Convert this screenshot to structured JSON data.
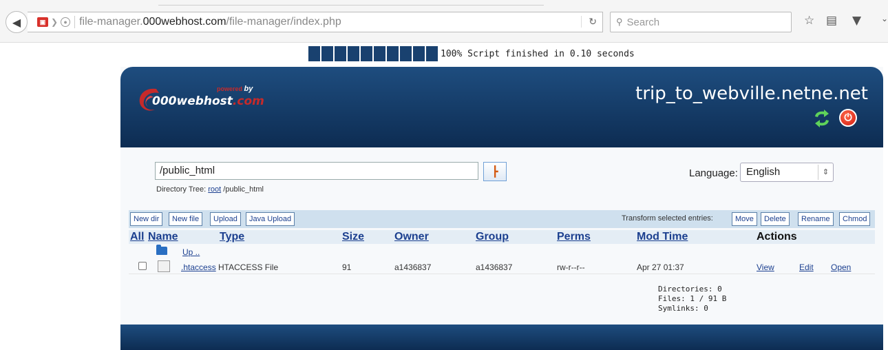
{
  "browser": {
    "url_prefix": "file-manager.",
    "url_host": "000webhost.com",
    "url_path": "/file-manager/index.php",
    "search_placeholder": "Search"
  },
  "progress": {
    "percent": 100,
    "text": "100% Script finished in 0.10 seconds"
  },
  "header": {
    "logo_powered": "powered",
    "logo_by": "by",
    "logo_name": "000webhost",
    "logo_suffix": ".com",
    "site_name": "trip_to_webville.netne.net"
  },
  "path": {
    "value": "/public_html",
    "tree_label": "Directory Tree:",
    "tree_root": "root",
    "tree_current": "/public_html"
  },
  "language": {
    "label": "Language:",
    "selected": "English"
  },
  "actions": {
    "new_dir": "New dir",
    "new_file": "New file",
    "upload": "Upload",
    "java_upload": "Java Upload",
    "transform_label": "Transform selected entries:",
    "move": "Move",
    "delete": "Delete",
    "rename": "Rename",
    "chmod": "Chmod"
  },
  "columns": {
    "all": "All",
    "name": "Name",
    "type": "Type",
    "size": "Size",
    "owner": "Owner",
    "group": "Group",
    "perms": "Perms",
    "mod_time": "Mod Time",
    "actions": "Actions"
  },
  "up_link": "Up ..",
  "files": [
    {
      "name": ".htaccess",
      "type": "HTACCESS File",
      "size": "91",
      "owner": "a1436837",
      "group": "a1436837",
      "perms": "rw-r--r--",
      "mod_time": "Apr 27 01:37",
      "view": "View",
      "edit": "Edit",
      "open": "Open"
    }
  ],
  "summary": {
    "directories": "Directories: 0",
    "files": "Files: 1 / 91 B",
    "symlinks": "Symlinks: 0"
  }
}
